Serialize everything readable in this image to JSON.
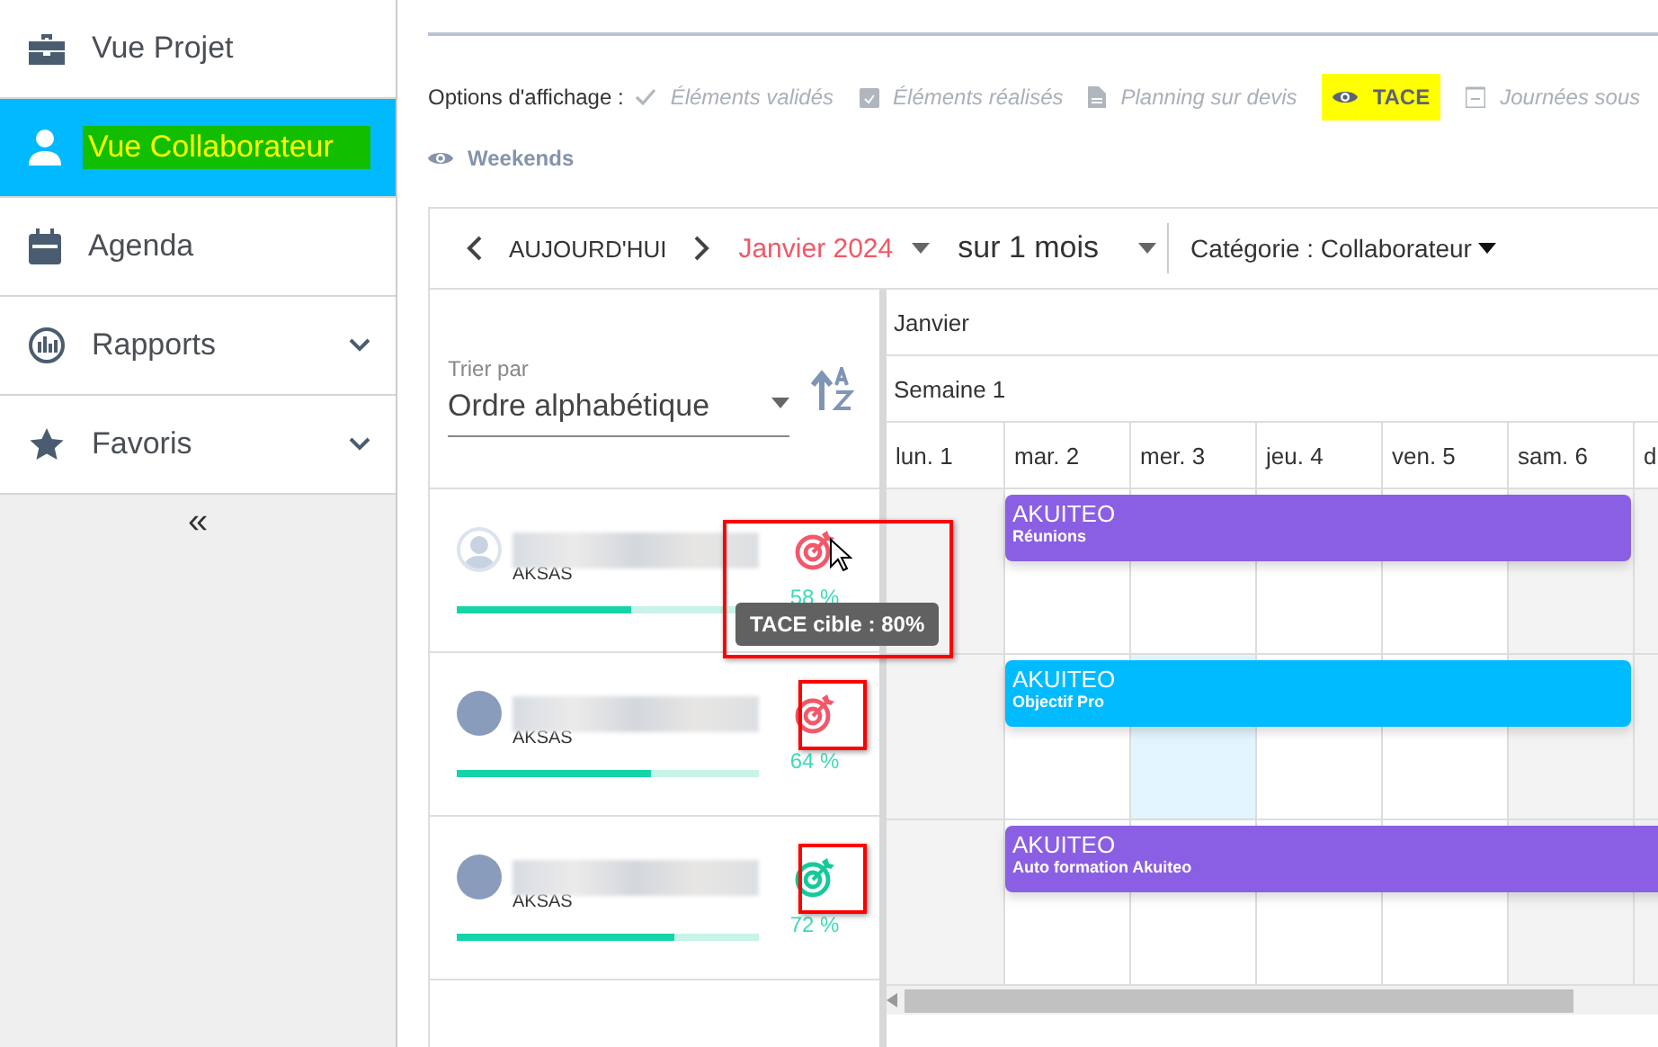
{
  "sidebar": {
    "items": [
      {
        "label": "Vue Projet",
        "selected": false,
        "highlighted": false,
        "expandable": false
      },
      {
        "label": "Vue Collaborateur",
        "selected": true,
        "highlighted": true,
        "expandable": false
      },
      {
        "label": "Agenda",
        "selected": false,
        "highlighted": false,
        "expandable": false
      },
      {
        "label": "Rapports",
        "selected": false,
        "highlighted": false,
        "expandable": true
      },
      {
        "label": "Favoris",
        "selected": false,
        "highlighted": false,
        "expandable": true
      }
    ],
    "collapse": "«"
  },
  "display_options": {
    "label": "Options d'affichage :",
    "rows": [
      [
        {
          "label": "Éléments validés",
          "on": false,
          "highlighted": false
        },
        {
          "label": "Éléments réalisés",
          "on": false,
          "highlighted": false
        },
        {
          "label": "Planning sur devis",
          "on": false,
          "highlighted": false
        },
        {
          "label": "TACE",
          "on": true,
          "highlighted": true
        },
        {
          "label": "Journées sous",
          "on": false,
          "highlighted": false
        }
      ],
      [
        {
          "label": "Weekends",
          "on": true,
          "highlighted": false
        }
      ]
    ]
  },
  "toolbar": {
    "today": "AUJOURD'HUI",
    "period": "Janvier 2024",
    "range": "sur 1 mois",
    "category": "Catégorie : Collaborateur"
  },
  "sort": {
    "label": "Trier par",
    "value": "Ordre alphabétique"
  },
  "timeline": {
    "month": "Janvier",
    "week": "Semaine 1",
    "days": [
      {
        "label": "lun. 1",
        "off": true
      },
      {
        "label": "mar. 2",
        "off": false
      },
      {
        "label": "mer. 3",
        "off": false
      },
      {
        "label": "jeu. 4",
        "off": false
      },
      {
        "label": "ven. 5",
        "off": false
      },
      {
        "label": "sam. 6",
        "off": true
      },
      {
        "label": "d",
        "off": true
      }
    ]
  },
  "resources": [
    {
      "avatar": {
        "kind": "silhouette"
      },
      "team": "AKSAS",
      "level": 0.58,
      "percent": "58 %",
      "target_met": false,
      "annotated": true,
      "tooltip": "TACE cible : 80%",
      "cells": [
        {
          "highlighted": false
        },
        {
          "highlighted": false
        },
        {
          "highlighted": false
        },
        {
          "highlighted": false
        },
        {
          "highlighted": false
        },
        {
          "highlighted": false
        },
        {
          "highlighted": false
        }
      ],
      "event": {
        "title": "AKUITEO",
        "subtitle": "Réunions",
        "color": "#8a5fe3",
        "continues": false
      }
    },
    {
      "avatar": {
        "kind": "photo"
      },
      "team": "AKSAS",
      "level": 0.64,
      "percent": "64 %",
      "target_met": false,
      "annotated": true,
      "cells": [
        {
          "highlighted": false
        },
        {
          "highlighted": false
        },
        {
          "highlighted": true
        },
        {
          "highlighted": false
        },
        {
          "highlighted": false
        },
        {
          "highlighted": false
        },
        {
          "highlighted": false
        }
      ],
      "event": {
        "title": "AKUITEO",
        "subtitle": "Objectif Pro",
        "color": "#00bbff",
        "continues": false
      }
    },
    {
      "avatar": {
        "kind": "photo"
      },
      "team": "AKSAS",
      "level": 0.72,
      "percent": "72 %",
      "target_met": true,
      "annotated": true,
      "cells": [
        {
          "highlighted": false
        },
        {
          "highlighted": false
        },
        {
          "highlighted": false
        },
        {
          "highlighted": false
        },
        {
          "highlighted": false
        },
        {
          "highlighted": false
        },
        {
          "highlighted": false
        }
      ],
      "event": {
        "title": "AKUITEO",
        "subtitle": "Auto formation Akuiteo",
        "color": "#8a5fe3",
        "continues": true
      }
    }
  ]
}
